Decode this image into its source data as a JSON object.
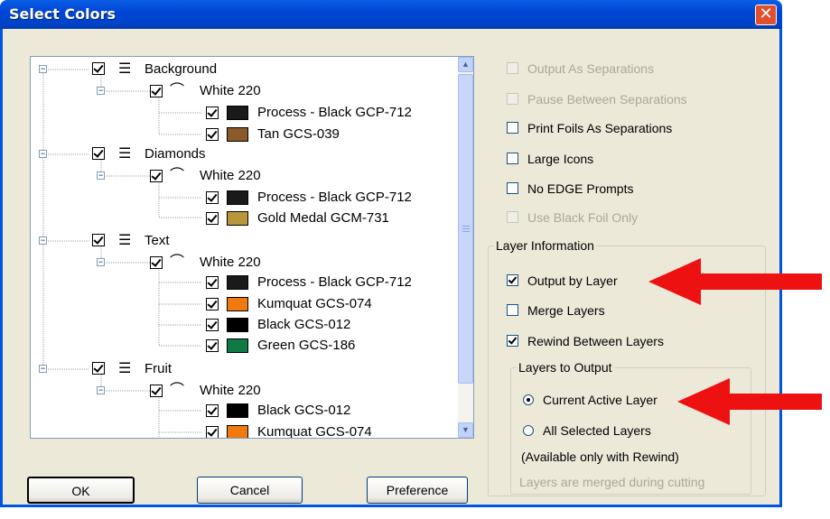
{
  "dialog": {
    "title": "Select Colors",
    "close_glyph": "✕"
  },
  "tree": {
    "layers": [
      {
        "name": "Background",
        "foil": "White 220",
        "colors": [
          {
            "label": "Process - Black GCP-712",
            "color": "#1a1a1a"
          },
          {
            "label": "Tan GCS-039",
            "color": "#8b5a2b"
          }
        ]
      },
      {
        "name": "Diamonds",
        "foil": "White 220",
        "colors": [
          {
            "label": "Process - Black GCP-712",
            "color": "#1a1a1a"
          },
          {
            "label": "Gold Medal GCM-731",
            "color": "#b8963c"
          }
        ]
      },
      {
        "name": "Text",
        "foil": "White 220",
        "colors": [
          {
            "label": "Process - Black GCP-712",
            "color": "#1a1a1a"
          },
          {
            "label": "Kumquat GCS-074",
            "color": "#f07a10"
          },
          {
            "label": "Black GCS-012",
            "color": "#000000"
          },
          {
            "label": "Green GCS-186",
            "color": "#0f7a45"
          }
        ]
      },
      {
        "name": "Fruit",
        "foil": "White 220",
        "colors": [
          {
            "label": "Black GCS-012",
            "color": "#000000"
          },
          {
            "label": "Kumquat GCS-074",
            "color": "#f07a10"
          }
        ]
      }
    ]
  },
  "options": {
    "output_as_separations": {
      "label": "Output As Separations",
      "checked": false,
      "enabled": false
    },
    "pause_between_separations": {
      "label": "Pause Between Separations",
      "checked": false,
      "enabled": false
    },
    "print_foils_as_separations": {
      "label": "Print Foils As Separations",
      "checked": false,
      "enabled": true
    },
    "large_icons": {
      "label": "Large Icons",
      "checked": false,
      "enabled": true
    },
    "no_edge_prompts": {
      "label": "No EDGE Prompts",
      "checked": false,
      "enabled": true
    },
    "use_black_foil_only": {
      "label": "Use Black Foil Only",
      "checked": false,
      "enabled": false
    }
  },
  "layer_information": {
    "title": "Layer Information",
    "output_by_layer": {
      "label": "Output by Layer",
      "checked": true
    },
    "merge_layers": {
      "label": "Merge Layers",
      "checked": false
    },
    "rewind_between_layers": {
      "label": "Rewind Between Layers",
      "checked": true
    },
    "layers_to_output": {
      "title": "Layers to Output",
      "current_active_layer": {
        "label": "Current Active Layer",
        "selected": true
      },
      "all_selected_layers": {
        "label": "All Selected Layers",
        "selected": false
      },
      "available_note": "(Available only with Rewind)",
      "merged_note": "Layers are merged during cutting"
    }
  },
  "buttons": {
    "ok": "OK",
    "cancel": "Cancel",
    "preference": "Preference"
  },
  "annotation_color": "#ee1111"
}
